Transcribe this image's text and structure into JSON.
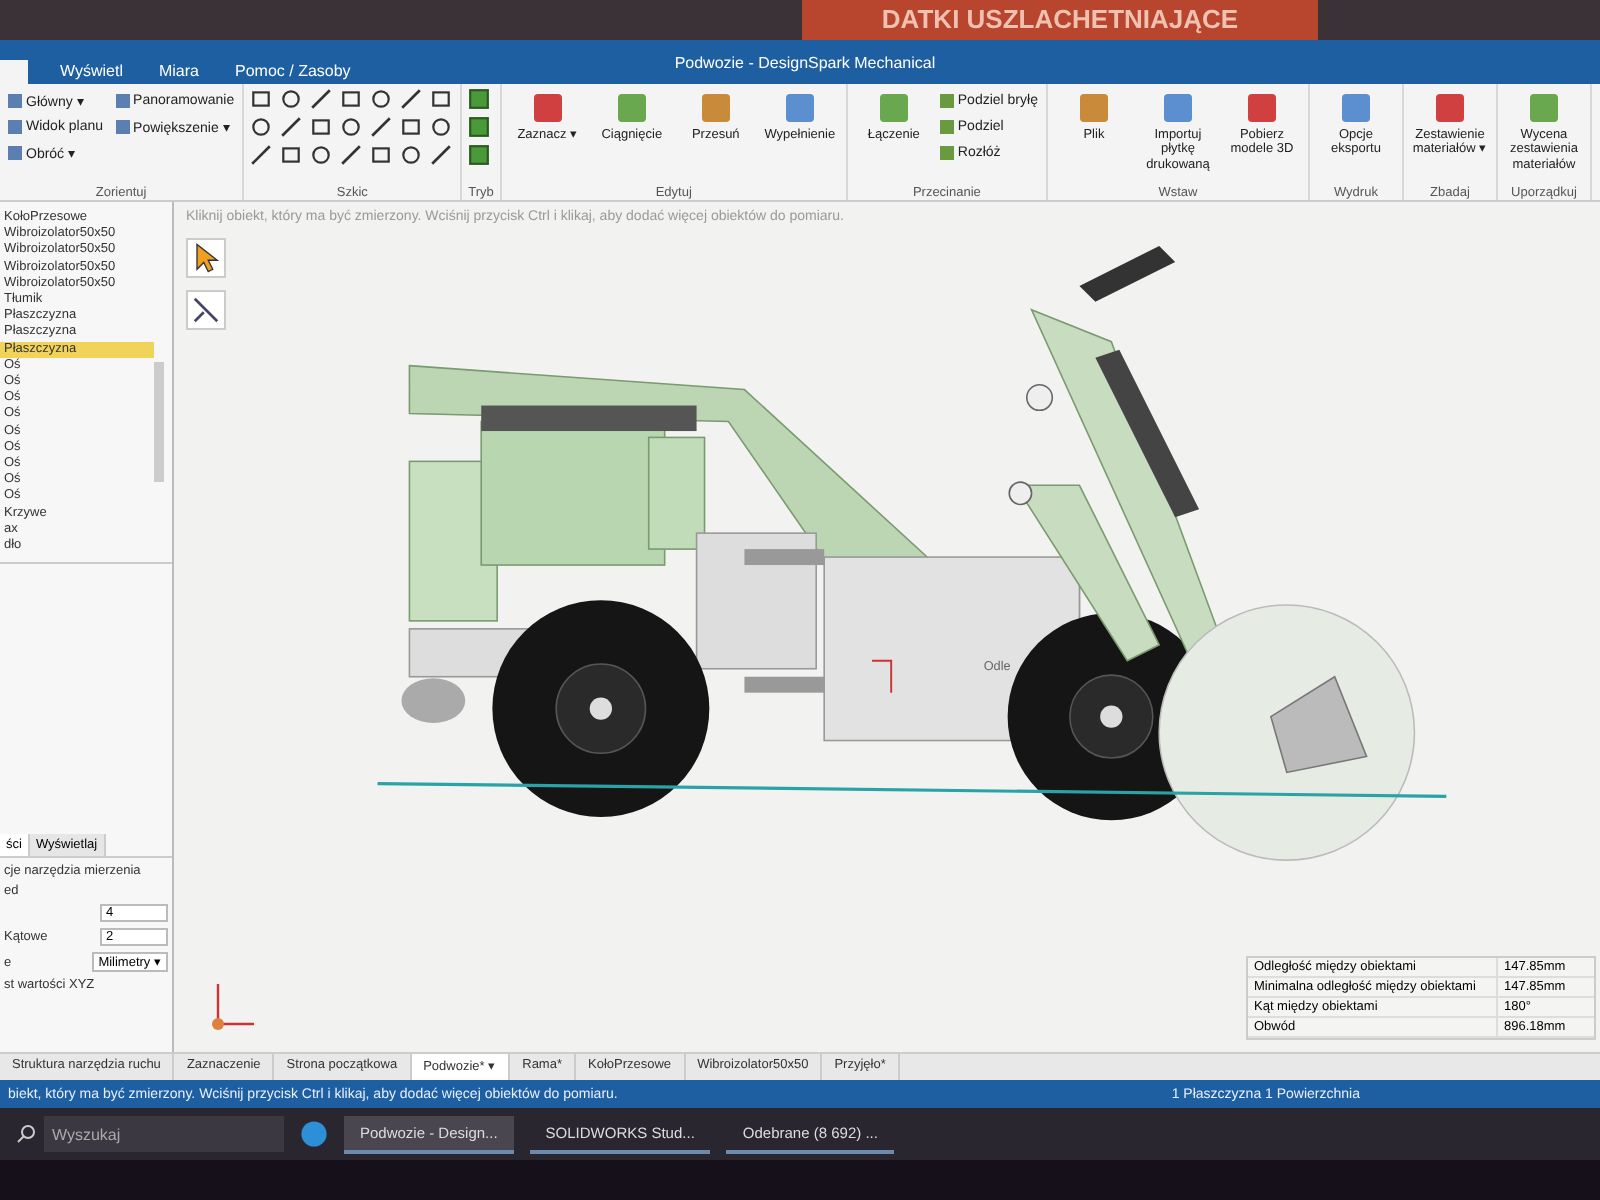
{
  "backdrop": {
    "banner": "DATKI USZLACHETNIAJĄCE"
  },
  "window": {
    "title": "Podwozie - DesignSpark Mechanical"
  },
  "ribbon_tabs": [
    {
      "label": "Wyświetl"
    },
    {
      "label": "Miara"
    },
    {
      "label": "Pomoc / Zasoby"
    }
  ],
  "ribbon_groups": [
    {
      "label": "Zorientuj",
      "kind": "small",
      "items": [
        "Główny ▾",
        "Widok planu",
        "Obróć ▾",
        "Panoramowanie",
        "Powiększenie ▾"
      ]
    },
    {
      "label": "Szkic",
      "kind": "sketch"
    },
    {
      "label": "Tryb",
      "kind": "mode"
    },
    {
      "label": "Edytuj",
      "kind": "big",
      "items": [
        "Zaznacz ▾",
        "Ciągnięcie",
        "Przesuń",
        "Wypełnienie"
      ]
    },
    {
      "label": "Przecinanie",
      "kind": "mixed",
      "items": [
        "Łączenie",
        "Podziel bryłę",
        "Podziel",
        "Rozłóż"
      ]
    },
    {
      "label": "Wstaw",
      "kind": "big",
      "items": [
        "Plik",
        "Importuj płytkę drukowaną",
        "Pobierz modele 3D"
      ]
    },
    {
      "label": "Wydruk",
      "kind": "big",
      "items": [
        "Opcje eksportu"
      ]
    },
    {
      "label": "Zbadaj",
      "kind": "big",
      "items": [
        "Zestawienie materiałów ▾"
      ]
    },
    {
      "label": "Uporządkuj",
      "kind": "big",
      "items": [
        "Wycena zestawienia materiałów"
      ]
    }
  ],
  "structure_tree": [
    {
      "label": "KołoPrzesowe",
      "selected": false
    },
    {
      "label": "Wibroizolator50x50",
      "selected": false
    },
    {
      "label": "Wibroizolator50x50",
      "selected": false
    },
    {
      "label": "Wibroizolator50x50",
      "selected": false
    },
    {
      "label": "Wibroizolator50x50",
      "selected": false
    },
    {
      "label": "Tłumik",
      "selected": false
    },
    {
      "label": "Płaszczyzna",
      "selected": false
    },
    {
      "label": "Płaszczyzna",
      "selected": false
    },
    {
      "label": "Płaszczyzna",
      "selected": true
    },
    {
      "label": "Oś",
      "selected": false
    },
    {
      "label": "Oś",
      "selected": false
    },
    {
      "label": "Oś",
      "selected": false
    },
    {
      "label": "Oś",
      "selected": false
    },
    {
      "label": "Oś",
      "selected": false
    },
    {
      "label": "Oś",
      "selected": false
    },
    {
      "label": "Oś",
      "selected": false
    },
    {
      "label": "Oś",
      "selected": false
    },
    {
      "label": "Oś",
      "selected": false
    },
    {
      "label": "Krzywe",
      "selected": false
    },
    {
      "label": "ax",
      "selected": false
    },
    {
      "label": "dło",
      "selected": false
    }
  ],
  "panel_tabs": [
    {
      "label": "ści",
      "selected": true
    },
    {
      "label": "Wyświetlaj",
      "selected": false
    }
  ],
  "options": {
    "heading": "cje narzędzia mierzenia",
    "subheading": "ed",
    "fields": [
      {
        "value": "4"
      },
      {
        "label": "Kątowe",
        "value": "2"
      },
      {
        "label": "e",
        "value": "Milimetry ▾"
      }
    ],
    "note": "st wartości XYZ"
  },
  "canvas": {
    "hint": "Kliknij obiekt, który ma być zmierzony. Wciśnij przycisk Ctrl i klikaj, aby dodać więcej obiektów do pomiaru.",
    "dimension": "Odle"
  },
  "measurements": [
    {
      "name": "Odległość między obiektami",
      "value": "147.85mm"
    },
    {
      "name": "Minimalna odległość między obiektami",
      "value": "147.85mm"
    },
    {
      "name": "Kąt między obiektami",
      "value": "180°"
    },
    {
      "name": "Obwód",
      "value": "896.18mm"
    }
  ],
  "doc_tabs": [
    {
      "label": "Struktura narzędzia ruchu",
      "selected": false
    },
    {
      "label": "Zaznaczenie",
      "selected": false
    },
    {
      "label": "Strona początkowa",
      "selected": false
    },
    {
      "label": "Podwozie* ▾",
      "selected": true
    },
    {
      "label": "Rama*",
      "selected": false
    },
    {
      "label": "KołoPrzesowe",
      "selected": false
    },
    {
      "label": "Wibroizolator50x50",
      "selected": false
    },
    {
      "label": "Przyjęło*",
      "selected": false
    }
  ],
  "status_bar": {
    "message": "biekt, który ma być zmierzony. Wciśnij przycisk Ctrl i klikaj, aby dodać więcej obiektów do pomiaru.",
    "selection": "1 Płaszczyzna  1 Powierzchnia"
  },
  "taskbar": {
    "search_placeholder": "Wyszukaj",
    "apps": [
      {
        "label": "Podwozie - Design...",
        "selected": true
      },
      {
        "label": "SOLIDWORKS Stud...",
        "selected": false
      },
      {
        "label": "Odebrane (8 692) ...",
        "selected": false
      }
    ]
  }
}
